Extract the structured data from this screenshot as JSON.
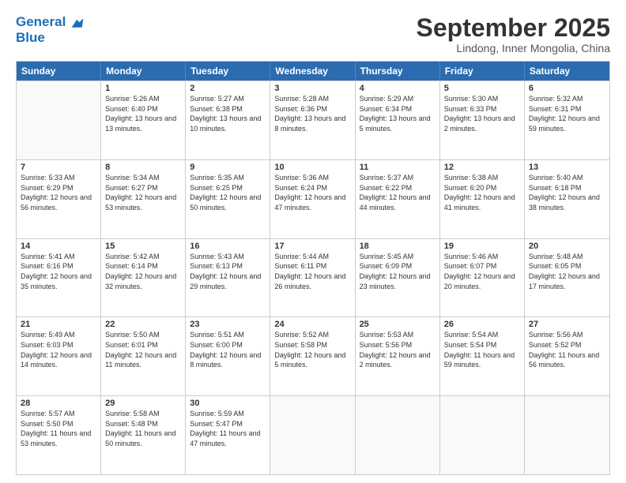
{
  "header": {
    "logo_line1": "General",
    "logo_line2": "Blue",
    "month": "September 2025",
    "location": "Lindong, Inner Mongolia, China"
  },
  "weekdays": [
    "Sunday",
    "Monday",
    "Tuesday",
    "Wednesday",
    "Thursday",
    "Friday",
    "Saturday"
  ],
  "weeks": [
    [
      {
        "day": "",
        "empty": true
      },
      {
        "day": "1",
        "sunrise": "Sunrise: 5:26 AM",
        "sunset": "Sunset: 6:40 PM",
        "daylight": "Daylight: 13 hours and 13 minutes."
      },
      {
        "day": "2",
        "sunrise": "Sunrise: 5:27 AM",
        "sunset": "Sunset: 6:38 PM",
        "daylight": "Daylight: 13 hours and 10 minutes."
      },
      {
        "day": "3",
        "sunrise": "Sunrise: 5:28 AM",
        "sunset": "Sunset: 6:36 PM",
        "daylight": "Daylight: 13 hours and 8 minutes."
      },
      {
        "day": "4",
        "sunrise": "Sunrise: 5:29 AM",
        "sunset": "Sunset: 6:34 PM",
        "daylight": "Daylight: 13 hours and 5 minutes."
      },
      {
        "day": "5",
        "sunrise": "Sunrise: 5:30 AM",
        "sunset": "Sunset: 6:33 PM",
        "daylight": "Daylight: 13 hours and 2 minutes."
      },
      {
        "day": "6",
        "sunrise": "Sunrise: 5:32 AM",
        "sunset": "Sunset: 6:31 PM",
        "daylight": "Daylight: 12 hours and 59 minutes."
      }
    ],
    [
      {
        "day": "7",
        "sunrise": "Sunrise: 5:33 AM",
        "sunset": "Sunset: 6:29 PM",
        "daylight": "Daylight: 12 hours and 56 minutes."
      },
      {
        "day": "8",
        "sunrise": "Sunrise: 5:34 AM",
        "sunset": "Sunset: 6:27 PM",
        "daylight": "Daylight: 12 hours and 53 minutes."
      },
      {
        "day": "9",
        "sunrise": "Sunrise: 5:35 AM",
        "sunset": "Sunset: 6:25 PM",
        "daylight": "Daylight: 12 hours and 50 minutes."
      },
      {
        "day": "10",
        "sunrise": "Sunrise: 5:36 AM",
        "sunset": "Sunset: 6:24 PM",
        "daylight": "Daylight: 12 hours and 47 minutes."
      },
      {
        "day": "11",
        "sunrise": "Sunrise: 5:37 AM",
        "sunset": "Sunset: 6:22 PM",
        "daylight": "Daylight: 12 hours and 44 minutes."
      },
      {
        "day": "12",
        "sunrise": "Sunrise: 5:38 AM",
        "sunset": "Sunset: 6:20 PM",
        "daylight": "Daylight: 12 hours and 41 minutes."
      },
      {
        "day": "13",
        "sunrise": "Sunrise: 5:40 AM",
        "sunset": "Sunset: 6:18 PM",
        "daylight": "Daylight: 12 hours and 38 minutes."
      }
    ],
    [
      {
        "day": "14",
        "sunrise": "Sunrise: 5:41 AM",
        "sunset": "Sunset: 6:16 PM",
        "daylight": "Daylight: 12 hours and 35 minutes."
      },
      {
        "day": "15",
        "sunrise": "Sunrise: 5:42 AM",
        "sunset": "Sunset: 6:14 PM",
        "daylight": "Daylight: 12 hours and 32 minutes."
      },
      {
        "day": "16",
        "sunrise": "Sunrise: 5:43 AM",
        "sunset": "Sunset: 6:13 PM",
        "daylight": "Daylight: 12 hours and 29 minutes."
      },
      {
        "day": "17",
        "sunrise": "Sunrise: 5:44 AM",
        "sunset": "Sunset: 6:11 PM",
        "daylight": "Daylight: 12 hours and 26 minutes."
      },
      {
        "day": "18",
        "sunrise": "Sunrise: 5:45 AM",
        "sunset": "Sunset: 6:09 PM",
        "daylight": "Daylight: 12 hours and 23 minutes."
      },
      {
        "day": "19",
        "sunrise": "Sunrise: 5:46 AM",
        "sunset": "Sunset: 6:07 PM",
        "daylight": "Daylight: 12 hours and 20 minutes."
      },
      {
        "day": "20",
        "sunrise": "Sunrise: 5:48 AM",
        "sunset": "Sunset: 6:05 PM",
        "daylight": "Daylight: 12 hours and 17 minutes."
      }
    ],
    [
      {
        "day": "21",
        "sunrise": "Sunrise: 5:49 AM",
        "sunset": "Sunset: 6:03 PM",
        "daylight": "Daylight: 12 hours and 14 minutes."
      },
      {
        "day": "22",
        "sunrise": "Sunrise: 5:50 AM",
        "sunset": "Sunset: 6:01 PM",
        "daylight": "Daylight: 12 hours and 11 minutes."
      },
      {
        "day": "23",
        "sunrise": "Sunrise: 5:51 AM",
        "sunset": "Sunset: 6:00 PM",
        "daylight": "Daylight: 12 hours and 8 minutes."
      },
      {
        "day": "24",
        "sunrise": "Sunrise: 5:52 AM",
        "sunset": "Sunset: 5:58 PM",
        "daylight": "Daylight: 12 hours and 5 minutes."
      },
      {
        "day": "25",
        "sunrise": "Sunrise: 5:53 AM",
        "sunset": "Sunset: 5:56 PM",
        "daylight": "Daylight: 12 hours and 2 minutes."
      },
      {
        "day": "26",
        "sunrise": "Sunrise: 5:54 AM",
        "sunset": "Sunset: 5:54 PM",
        "daylight": "Daylight: 11 hours and 59 minutes."
      },
      {
        "day": "27",
        "sunrise": "Sunrise: 5:56 AM",
        "sunset": "Sunset: 5:52 PM",
        "daylight": "Daylight: 11 hours and 56 minutes."
      }
    ],
    [
      {
        "day": "28",
        "sunrise": "Sunrise: 5:57 AM",
        "sunset": "Sunset: 5:50 PM",
        "daylight": "Daylight: 11 hours and 53 minutes."
      },
      {
        "day": "29",
        "sunrise": "Sunrise: 5:58 AM",
        "sunset": "Sunset: 5:48 PM",
        "daylight": "Daylight: 11 hours and 50 minutes."
      },
      {
        "day": "30",
        "sunrise": "Sunrise: 5:59 AM",
        "sunset": "Sunset: 5:47 PM",
        "daylight": "Daylight: 11 hours and 47 minutes."
      },
      {
        "day": "",
        "empty": true
      },
      {
        "day": "",
        "empty": true
      },
      {
        "day": "",
        "empty": true
      },
      {
        "day": "",
        "empty": true
      }
    ]
  ]
}
